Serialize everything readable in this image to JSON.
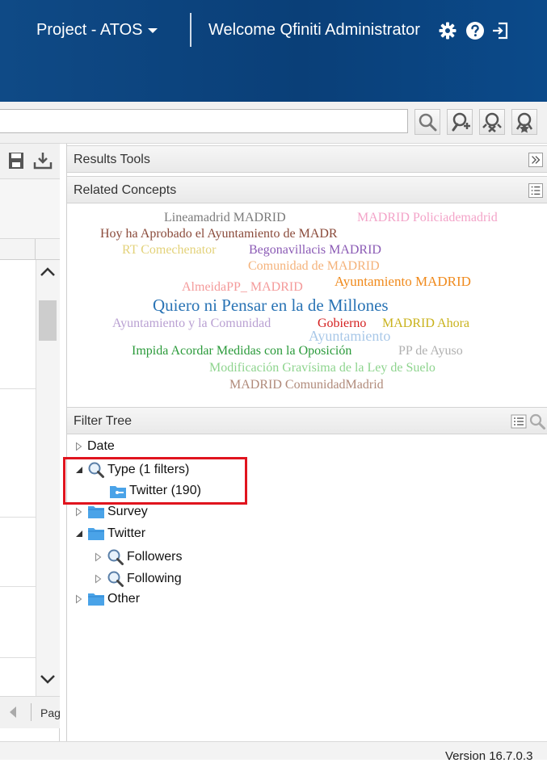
{
  "header": {
    "project_label": "Project - ATOS",
    "welcome_text": "Welcome Qfiniti Administrator"
  },
  "search": {
    "value": ""
  },
  "left_panel": {
    "paging_label": "Pag"
  },
  "results_tools": {
    "title": "Results Tools"
  },
  "related_concepts": {
    "title": "Related Concepts",
    "terms": [
      {
        "text": "Lineamadrid MADRID",
        "color": "#7a7a7a"
      },
      {
        "text": "MADRID Policiademadrid",
        "color": "#f3a3c8"
      },
      {
        "text": "Hoy ha Aprobado el Ayuntamiento de MADR",
        "color": "#8a4a3a"
      },
      {
        "text": "RT Comechenator",
        "color": "#e3d27a"
      },
      {
        "text": "Begonavillacis MADRID",
        "color": "#8b5bb5"
      },
      {
        "text": "Comunidad de MADRID",
        "color": "#f4b27a"
      },
      {
        "text": "AlmeidaPP_ MADRID",
        "color": "#f49a9a"
      },
      {
        "text": "Ayuntamiento MADRID",
        "color": "#f08a1c"
      },
      {
        "text": "Quiero ni Pensar en la de Millones",
        "color": "#2a74b5"
      },
      {
        "text": "Ayuntamiento y la Comunidad",
        "color": "#b9a0d2"
      },
      {
        "text": "Gobierno",
        "color": "#d42020"
      },
      {
        "text": "MADRID Ahora",
        "color": "#c9b21a"
      },
      {
        "text": "Ayuntamiento",
        "color": "#a9c8e8"
      },
      {
        "text": "Impida Acordar Medidas con la Oposición",
        "color": "#2a9a3a"
      },
      {
        "text": "PP de Ayuso",
        "color": "#b0b0b0"
      },
      {
        "text": "Modificación Gravísima de la Ley de Suelo",
        "color": "#8ed48e"
      },
      {
        "text": "MADRID ComunidadMadrid",
        "color": "#b08a7a"
      }
    ]
  },
  "filter_tree": {
    "title": "Filter Tree",
    "nodes": [
      {
        "label": "Date"
      },
      {
        "label": "Type (1 filters)"
      },
      {
        "label": "Twitter (190)"
      },
      {
        "label": "Survey"
      },
      {
        "label": "Twitter"
      },
      {
        "label": "Followers"
      },
      {
        "label": "Following"
      },
      {
        "label": "Other"
      }
    ]
  },
  "footer": {
    "version": "Version 16.7.0.3"
  },
  "colors": {
    "header_bg": "#0c4580",
    "highlight": "#e0141e",
    "folder": "#4aa3e8"
  }
}
